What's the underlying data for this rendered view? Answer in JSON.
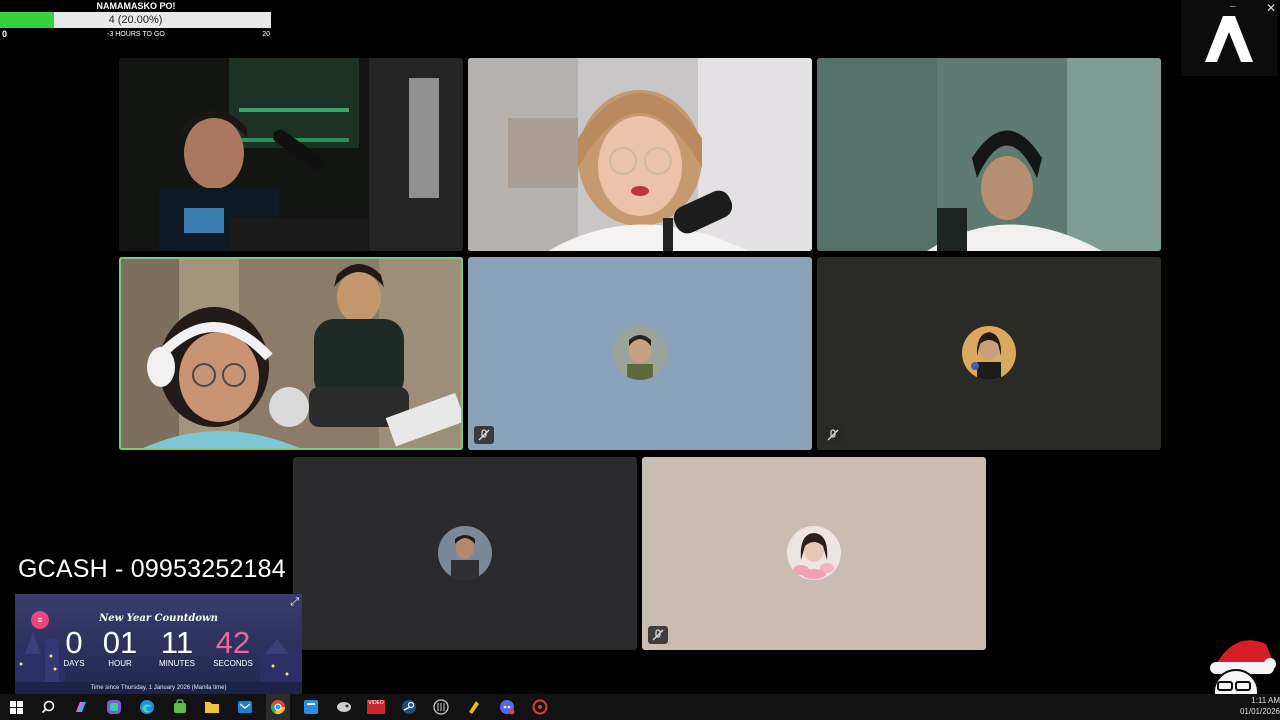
{
  "goal": {
    "title": "NAMAMASKO PO!",
    "progress_text": "4 (20.00%)",
    "progress_fraction": 0.2,
    "min_label": "0",
    "max_label": "20",
    "subtitle": "-3 HOURS TO GO",
    "fill_color": "#34d23b"
  },
  "logo": {
    "icon": "a-brand-logo"
  },
  "meeting": {
    "tiles": [
      {
        "id": "participant-1",
        "kind": "video",
        "muted": false,
        "speaking": false
      },
      {
        "id": "participant-2",
        "kind": "video",
        "muted": false,
        "speaking": false
      },
      {
        "id": "participant-3",
        "kind": "video",
        "muted": false,
        "speaking": false
      },
      {
        "id": "participant-4",
        "kind": "video",
        "muted": false,
        "speaking": true
      },
      {
        "id": "participant-5",
        "kind": "avatar",
        "muted": true,
        "bg": "#8ba2bb"
      },
      {
        "id": "participant-6",
        "kind": "avatar",
        "muted": true,
        "bg": "#2a2a26"
      },
      {
        "id": "participant-7",
        "kind": "avatar",
        "muted": false,
        "bg": "#2a2a2c"
      },
      {
        "id": "participant-8",
        "kind": "avatar",
        "muted": true,
        "bg": "#c9bdb2"
      }
    ]
  },
  "gcash": {
    "text": "GCASH - 09953252184"
  },
  "countdown": {
    "title": "New Year Countdown",
    "days": "0",
    "days_label": "DAYS",
    "hours": "01",
    "hours_label": "HOUR",
    "minutes": "11",
    "minutes_label": "MINUTES",
    "seconds": "42",
    "seconds_label": "SECONDS",
    "footer": "Time since Thursday, 1 January 2026 (Manila time)"
  },
  "taskbar": {
    "icons": [
      "windows-start-icon",
      "search-icon",
      "copilot-icon",
      "edge-icon",
      "edge-alt-icon",
      "store-icon",
      "file-explorer-icon",
      "outlook-icon",
      "chrome-icon",
      "app-blue-icon",
      "app-bird-icon",
      "video-editor-icon",
      "steam-icon",
      "app-grid-icon",
      "app-yellow-icon",
      "discord-icon",
      "app-red-icon"
    ],
    "video_editor_label": "VIDEO",
    "time": "1:11 AM",
    "date": "01/01/2026"
  }
}
